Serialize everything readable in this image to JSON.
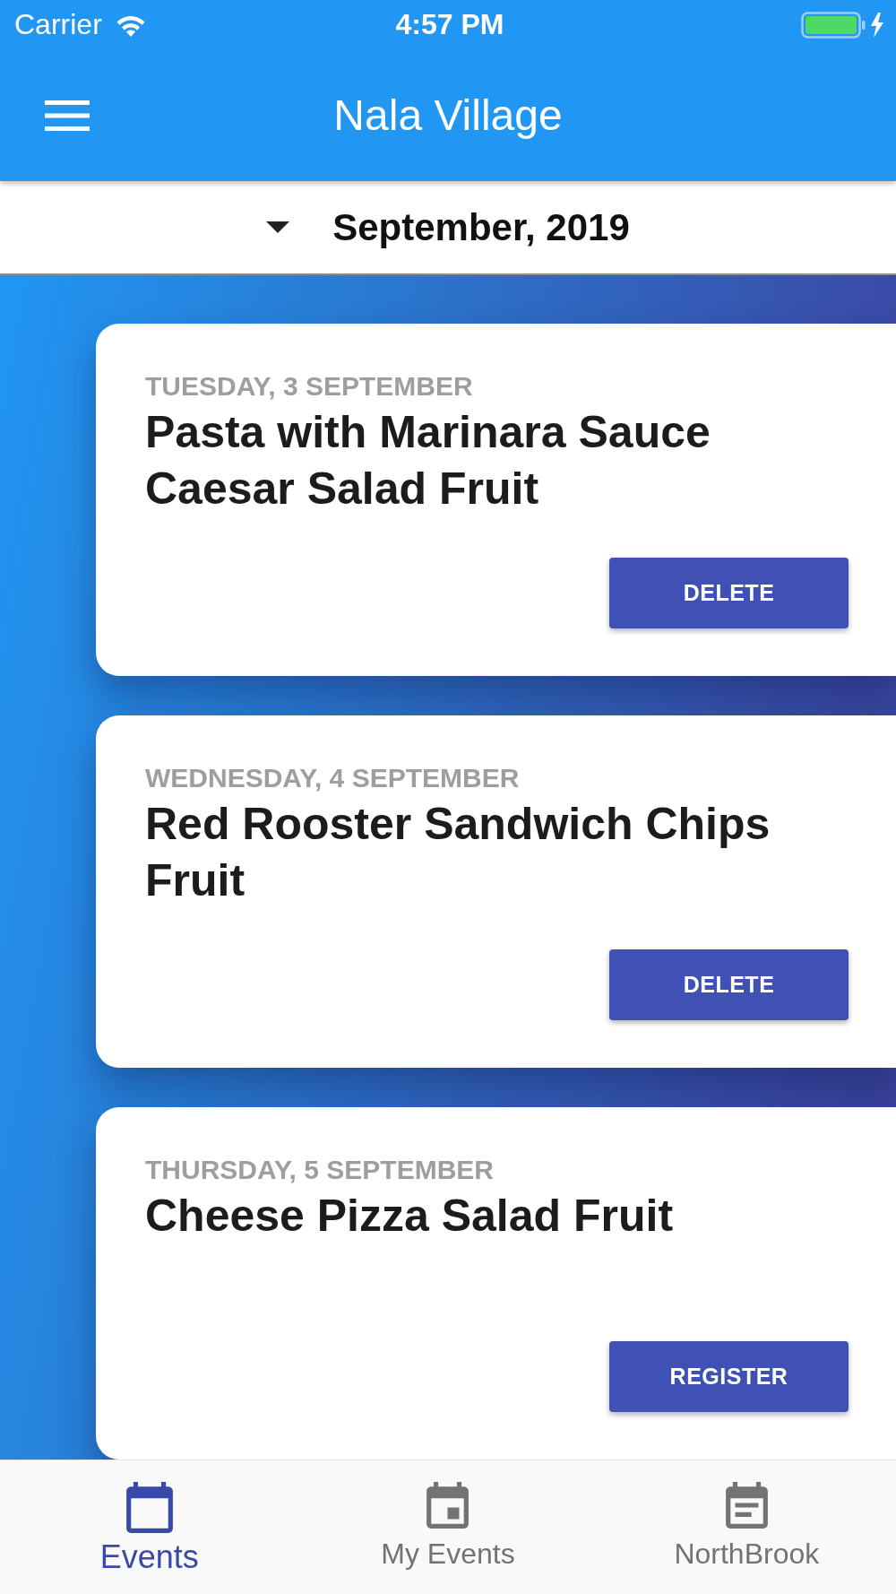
{
  "status_bar": {
    "carrier": "Carrier",
    "time": "4:57 PM"
  },
  "app_bar": {
    "title": "Nala Village"
  },
  "month_selector": {
    "label": "September, 2019"
  },
  "events": [
    {
      "date": "TUESDAY, 3 SEPTEMBER",
      "title": "Pasta with Marinara Sauce Caesar Salad Fruit",
      "action": "DELETE"
    },
    {
      "date": "WEDNESDAY, 4 SEPTEMBER",
      "title": "Red Rooster Sandwich Chips Fruit",
      "action": "DELETE"
    },
    {
      "date": "THURSDAY, 5 SEPTEMBER",
      "title": "Cheese Pizza Salad Fruit",
      "action": "REGISTER"
    }
  ],
  "bottom_nav": [
    {
      "label": "Events",
      "kind": "calendar",
      "selected": true
    },
    {
      "label": "My Events",
      "kind": "day",
      "selected": false
    },
    {
      "label": "NorthBrook",
      "kind": "notes",
      "selected": false
    }
  ]
}
